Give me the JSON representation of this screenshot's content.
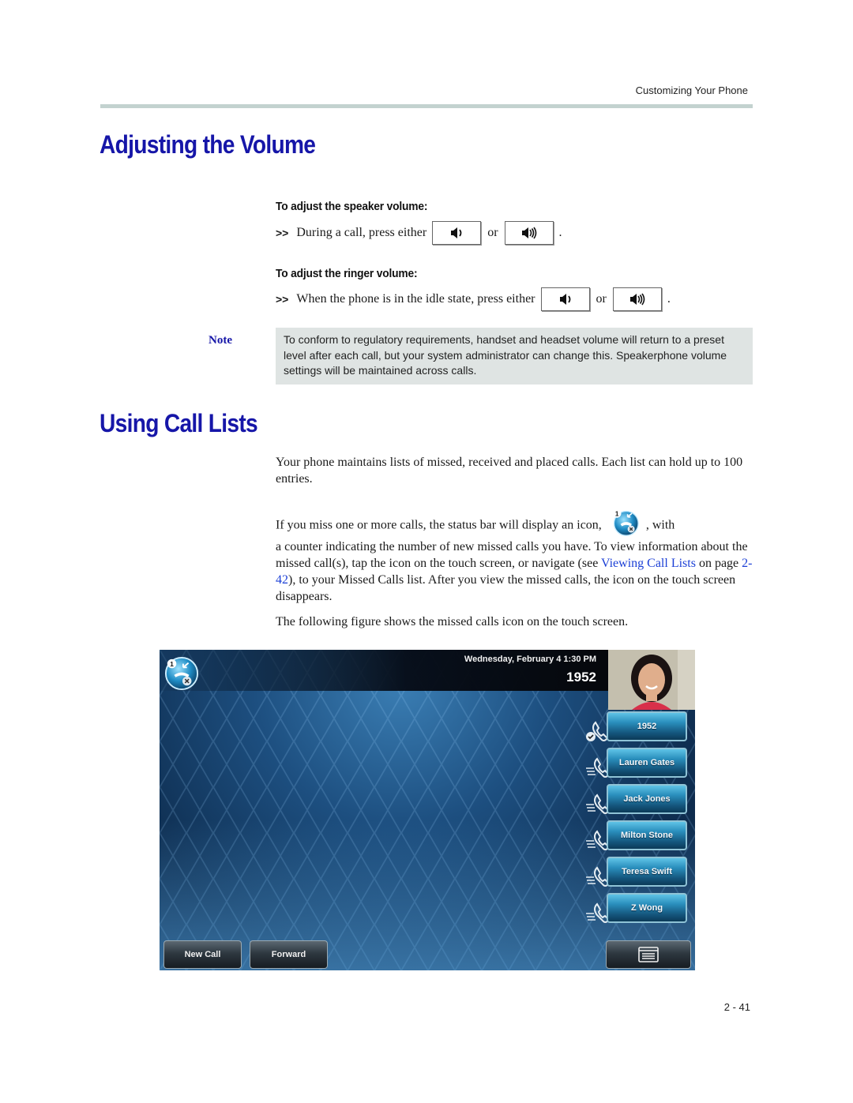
{
  "header": {
    "running_title": "Customizing Your Phone"
  },
  "section1": {
    "title": "Adjusting the Volume",
    "procedures": [
      {
        "heading": "To adjust the speaker volume:",
        "bullet": ">>",
        "text": "During a call, press either",
        "connector": "or",
        "end": ".",
        "keys": [
          "volume-down-key",
          "volume-up-key"
        ]
      },
      {
        "heading": "To adjust the ringer volume:",
        "bullet": ">>",
        "text": "When the phone is in the idle state, press either",
        "connector": "or",
        "end": ".",
        "keys": [
          "volume-down-key",
          "volume-up-key"
        ]
      }
    ],
    "note": {
      "label": "Note",
      "text": "To conform to regulatory requirements, handset and headset volume will return to a preset level after each call, but your system administrator can change this. Speakerphone volume settings will be maintained across calls."
    }
  },
  "section2": {
    "title": "Using Call Lists",
    "para1": "Your phone maintains lists of missed, received and placed calls. Each list can hold up to 100 entries.",
    "para2_before": "If you miss one or more calls, the status bar will display an icon,",
    "para2_after": ", with",
    "para3_a": "a counter indicating the number of new missed calls you have. To view information about the missed call(s), tap the icon on the touch screen, or navigate (see ",
    "para3_link": "Viewing Call Lists",
    "para3_b": " on page ",
    "para3_page_link": "2-42",
    "para3_c": "), to your Missed Calls list. After you view the missed calls, the icon on the touch screen disappears.",
    "para4": "The following figure shows the missed calls icon on the touch screen.",
    "missed_count": "1"
  },
  "phone_screen": {
    "datetime": "Wednesday, February 4  1:30 PM",
    "extension": "1952",
    "missed_count": "1",
    "lines": [
      {
        "label": "1952",
        "status": "registered"
      },
      {
        "label": "Lauren Gates",
        "status": "speed-dial"
      },
      {
        "label": "Jack Jones",
        "status": "speed-dial"
      },
      {
        "label": "Milton Stone",
        "status": "speed-dial"
      },
      {
        "label": "Teresa Swift",
        "status": "speed-dial"
      },
      {
        "label": "Z Wong",
        "status": "speed-dial"
      }
    ],
    "softkeys": {
      "new_call": "New Call",
      "forward": "Forward",
      "menu_icon": "menu-icon"
    }
  },
  "footer": {
    "page_number": "2 - 41"
  }
}
